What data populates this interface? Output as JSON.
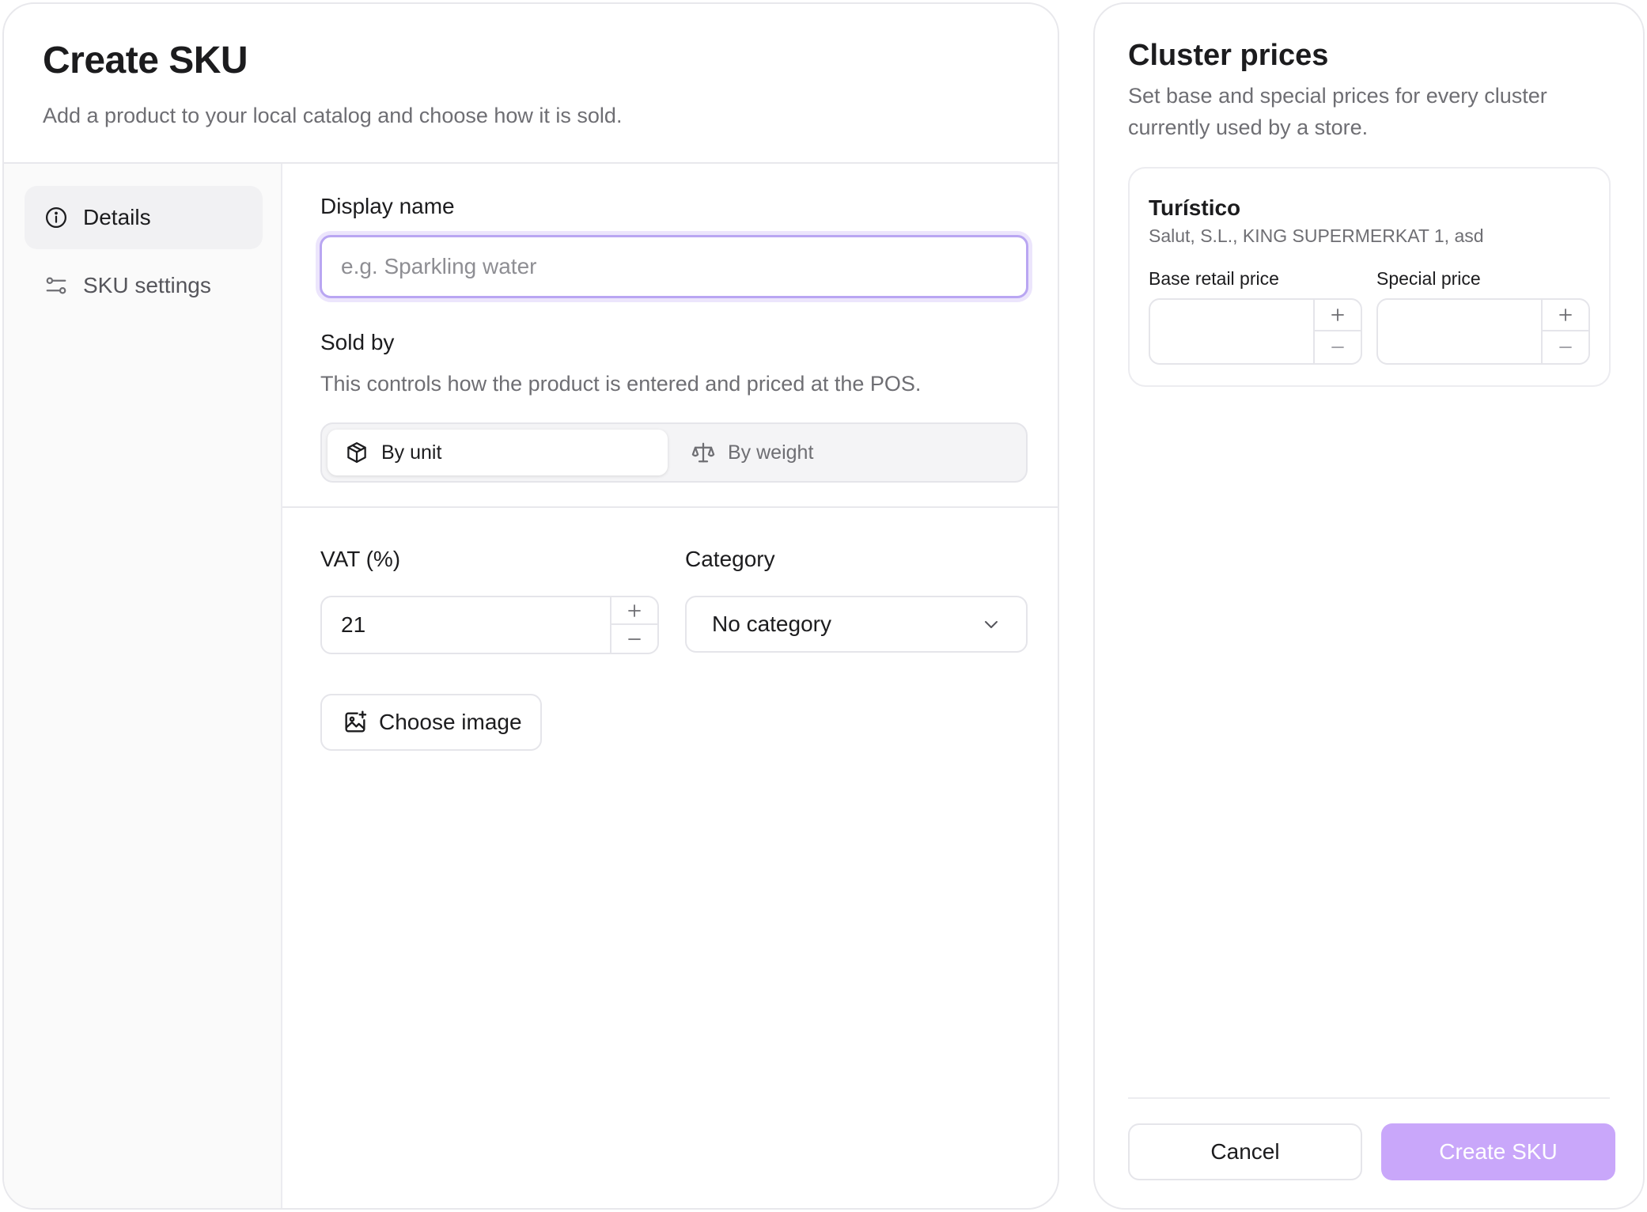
{
  "form": {
    "title": "Create SKU",
    "subtitle": "Add a product to your local catalog and choose how it is sold."
  },
  "nav": {
    "items": [
      {
        "label": "Details",
        "icon": "info-circle-icon",
        "active": true
      },
      {
        "label": "SKU settings",
        "icon": "sliders-icon",
        "active": false
      }
    ]
  },
  "details": {
    "display_name": {
      "label": "Display name",
      "placeholder": "e.g. Sparkling water",
      "value": ""
    },
    "sold_by": {
      "label": "Sold by",
      "helper": "This controls how the product is entered and priced at the POS.",
      "options": [
        {
          "label": "By unit",
          "icon": "box-icon",
          "selected": true
        },
        {
          "label": "By weight",
          "icon": "scale-icon",
          "selected": false
        }
      ]
    },
    "vat": {
      "label": "VAT (%)",
      "value": "21"
    },
    "category": {
      "label": "Category",
      "value": "No category"
    },
    "choose_image": {
      "label": "Choose image",
      "icon": "image-plus-icon"
    }
  },
  "cluster_prices": {
    "title": "Cluster prices",
    "subtitle": "Set base and special prices for every cluster currently used by a store.",
    "clusters": [
      {
        "name": "Turístico",
        "stores": "Salut, S.L., KING SUPERMERKAT 1, asd",
        "base_price_label": "Base retail price",
        "base_price_value": "",
        "special_price_label": "Special price",
        "special_price_value": ""
      }
    ]
  },
  "actions": {
    "cancel": "Cancel",
    "create": "Create SKU"
  },
  "colors": {
    "accent": "#c9a7fa",
    "focus_ring": "#b9a6f2",
    "text_primary": "#1c1c1e",
    "text_secondary": "#6e6e73",
    "border": "#e5e5ea"
  }
}
